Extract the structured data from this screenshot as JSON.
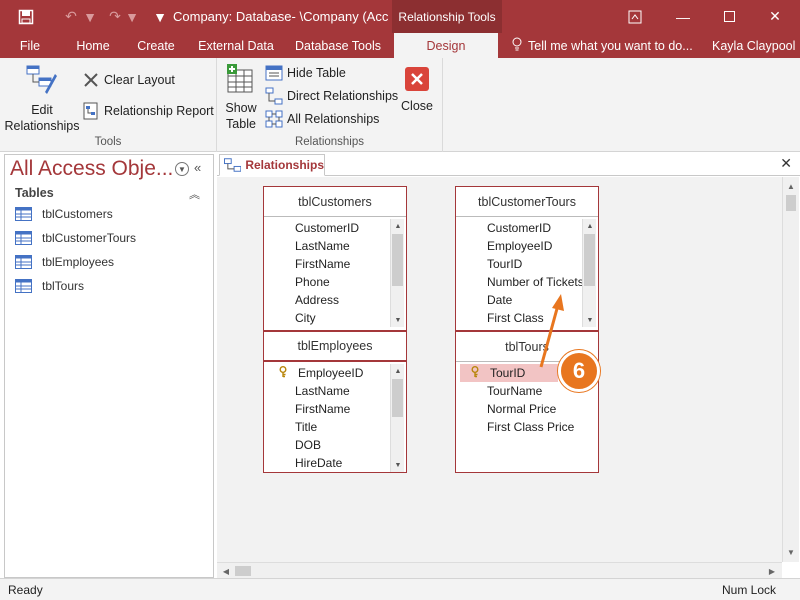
{
  "window": {
    "title": "Company: Database- \\Company (Acces...",
    "context_tab": "Relationship Tools",
    "user": "Kayla Claypool"
  },
  "quick_access": {
    "save": "save-icon",
    "undo": "undo-icon",
    "redo": "redo-icon"
  },
  "tabs": [
    {
      "label": "File"
    },
    {
      "label": "Home"
    },
    {
      "label": "Create"
    },
    {
      "label": "External Data"
    },
    {
      "label": "Database Tools"
    },
    {
      "label": "Design",
      "active": true
    }
  ],
  "tellme": "Tell me what you want to do...",
  "ribbon": {
    "tools": {
      "label": "Tools",
      "edit_relationships_1": "Edit",
      "edit_relationships_2": "Relationships",
      "clear_layout": "Clear Layout",
      "relationship_report": "Relationship Report"
    },
    "relationships": {
      "label": "Relationships",
      "show_table_1": "Show",
      "show_table_2": "Table",
      "hide_table": "Hide Table",
      "direct_relationships": "Direct Relationships",
      "all_relationships": "All Relationships",
      "close": "Close"
    }
  },
  "nav": {
    "title": "All Access Obje...",
    "section": "Tables",
    "items": [
      {
        "label": "tblCustomers"
      },
      {
        "label": "tblCustomerTours"
      },
      {
        "label": "tblEmployees"
      },
      {
        "label": "tblTours"
      }
    ]
  },
  "document": {
    "tab": "Relationships"
  },
  "tables": {
    "customers": {
      "name": "tblCustomers",
      "fields": [
        "CustomerID",
        "LastName",
        "FirstName",
        "Phone",
        "Address",
        "City"
      ]
    },
    "customer_tours": {
      "name": "tblCustomerTours",
      "fields": [
        "CustomerID",
        "EmployeeID",
        "TourID",
        "Number of Tickets",
        "Date",
        "First Class"
      ]
    },
    "employees": {
      "name": "tblEmployees",
      "fields": [
        "EmployeeID",
        "LastName",
        "FirstName",
        "Title",
        "DOB",
        "HireDate"
      ]
    },
    "tours": {
      "name": "tblTours",
      "fields": [
        "TourID",
        "TourName",
        "Normal Price",
        "First Class Price"
      ]
    }
  },
  "callout": "6",
  "status": {
    "left": "Ready",
    "right": "Num Lock"
  },
  "colors": {
    "accent": "#a4373a",
    "callout": "#e8761f",
    "highlight": "#f2c4c4"
  }
}
